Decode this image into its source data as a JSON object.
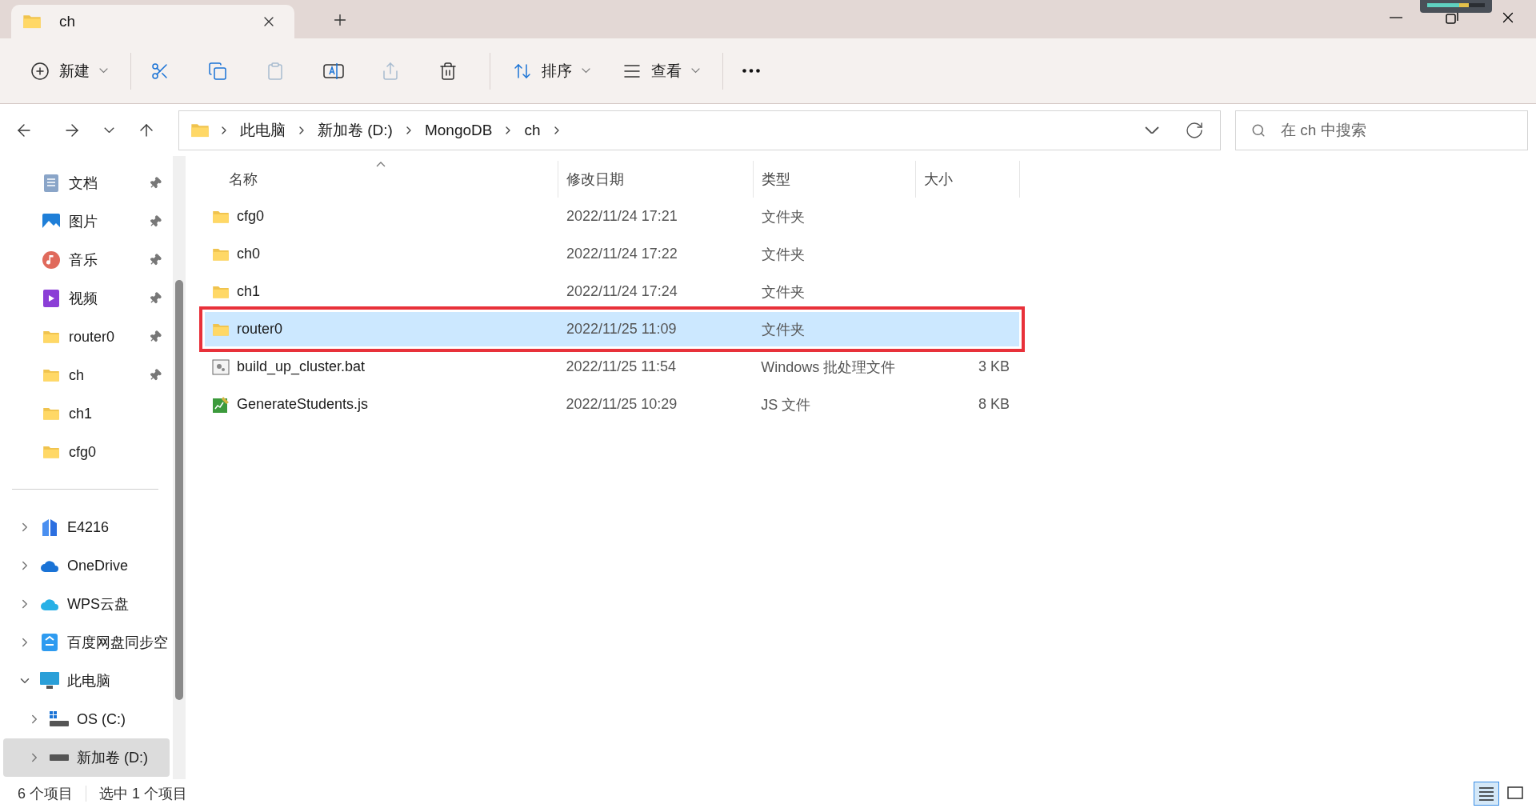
{
  "tab": {
    "title": "ch"
  },
  "toolbar": {
    "groups": [
      [
        {
          "kind": "new",
          "label": "新建",
          "disabled": false
        }
      ],
      [
        {
          "kind": "cut",
          "disabled": false
        },
        {
          "kind": "copy",
          "disabled": false
        },
        {
          "kind": "paste",
          "disabled": true
        },
        {
          "kind": "rename",
          "disabled": false
        },
        {
          "kind": "share",
          "disabled": true
        },
        {
          "kind": "delete",
          "disabled": false
        }
      ],
      [
        {
          "kind": "sort",
          "label": "排序",
          "disabled": false
        },
        {
          "kind": "view",
          "label": "查看",
          "disabled": false
        }
      ],
      [
        {
          "kind": "more",
          "disabled": false
        }
      ]
    ]
  },
  "address": {
    "crumbs": [
      "此电脑",
      "新加卷 (D:)",
      "MongoDB",
      "ch"
    ]
  },
  "search": {
    "placeholder": "在 ch 中搜索"
  },
  "sidebar": {
    "quick_access": [
      {
        "label": "文档",
        "kind": "documents",
        "pinned": true
      },
      {
        "label": "图片",
        "kind": "pictures",
        "pinned": true
      },
      {
        "label": "音乐",
        "kind": "music",
        "pinned": true
      },
      {
        "label": "视频",
        "kind": "videos",
        "pinned": true
      },
      {
        "label": "router0",
        "kind": "folder",
        "pinned": true
      },
      {
        "label": "ch",
        "kind": "folder",
        "pinned": true
      },
      {
        "label": "ch1",
        "kind": "folder",
        "pinned": false
      },
      {
        "label": "cfg0",
        "kind": "folder",
        "pinned": false
      }
    ],
    "tree": [
      {
        "label": "E4216",
        "kind": "building",
        "expanded": false,
        "selected": false
      },
      {
        "label": "OneDrive",
        "kind": "onedrive",
        "expanded": false,
        "selected": false
      },
      {
        "label": "WPS云盘",
        "kind": "wps",
        "expanded": false,
        "selected": false
      },
      {
        "label": "百度网盘同步空",
        "kind": "baidu",
        "expanded": false,
        "selected": false
      },
      {
        "label": "此电脑",
        "kind": "pc",
        "expanded": true,
        "selected": false,
        "children": [
          {
            "label": "OS (C:)",
            "kind": "system-drive",
            "expanded": false,
            "selected": false
          },
          {
            "label": "新加卷 (D:)",
            "kind": "drive",
            "expanded": false,
            "selected": true
          }
        ]
      }
    ]
  },
  "table": {
    "columns": [
      {
        "label": "名称",
        "sorted": true
      },
      {
        "label": "修改日期",
        "sorted": false
      },
      {
        "label": "类型",
        "sorted": false
      },
      {
        "label": "大小",
        "sorted": false
      }
    ],
    "rows": [
      {
        "kind": "folder",
        "name": "cfg0",
        "date": "2022/11/24 17:21",
        "type": "文件夹",
        "selected": false,
        "outlined": false
      },
      {
        "kind": "folder",
        "name": "ch0",
        "date": "2022/11/24 17:22",
        "type": "文件夹",
        "selected": false,
        "outlined": false
      },
      {
        "kind": "folder",
        "name": "ch1",
        "date": "2022/11/24 17:24",
        "type": "文件夹",
        "selected": false,
        "outlined": false
      },
      {
        "kind": "folder",
        "name": "router0",
        "date": "2022/11/25 11:09",
        "type": "文件夹",
        "selected": true,
        "outlined": true
      },
      {
        "kind": "batch",
        "name": "build_up_cluster.bat",
        "date": "2022/11/25 11:54",
        "type": "Windows 批处理文件",
        "size": "3 KB",
        "selected": false,
        "outlined": false
      },
      {
        "kind": "script",
        "name": "GenerateStudents.js",
        "date": "2022/11/25 10:29",
        "type": "JS 文件",
        "size": "8 KB",
        "selected": false,
        "outlined": false
      }
    ]
  },
  "status_bar": {
    "count": "6 个项目",
    "selection": "选中 1 个项目",
    "view_buttons": [
      {
        "kind": "details",
        "selected": true
      },
      {
        "kind": "tiles",
        "selected": false
      }
    ]
  }
}
